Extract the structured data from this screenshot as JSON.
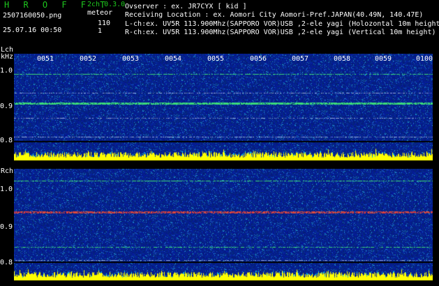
{
  "header": {
    "title": "H R O F F T",
    "version": "2ch 0.3.0",
    "mode": "meteor",
    "filename": "2507160050.png",
    "datetime": "25.07.16 00:50",
    "l_count": "110",
    "r_count": "1",
    "info_lines": [
      "Ovserver          : ex. JR7CYX [ kid ]",
      "Receiving Location : ex. Aomori City Aomori-Pref.JAPAN(40.49N, 140.47E)",
      "L-ch:ex. UV5R 113.900Mhz(SAPPORO VOR)USB ,2-ele yagi (Holozontal 10m height)",
      "R-ch:ex. UV5R 113.900Mhz(SAPPORO VOR)USB ,2-ele yagi (Vertical 10m height)"
    ]
  },
  "lch": {
    "label": "Lch",
    "unit": "kHz",
    "ticks": [
      "1.0",
      "0.9",
      "0.8"
    ],
    "time_labels": [
      "0051",
      "0052",
      "0053",
      "0054",
      "0055",
      "0056",
      "0057",
      "0058",
      "0059",
      "0100"
    ]
  },
  "rch": {
    "label": "Rch",
    "ticks": [
      "1.0",
      "0.9",
      "0.8"
    ]
  },
  "colors": {
    "background": "#000000",
    "spectrum_base": "#0a1e8c",
    "title_green": "#1ec81e",
    "activity_yellow": "#ffff00"
  }
}
